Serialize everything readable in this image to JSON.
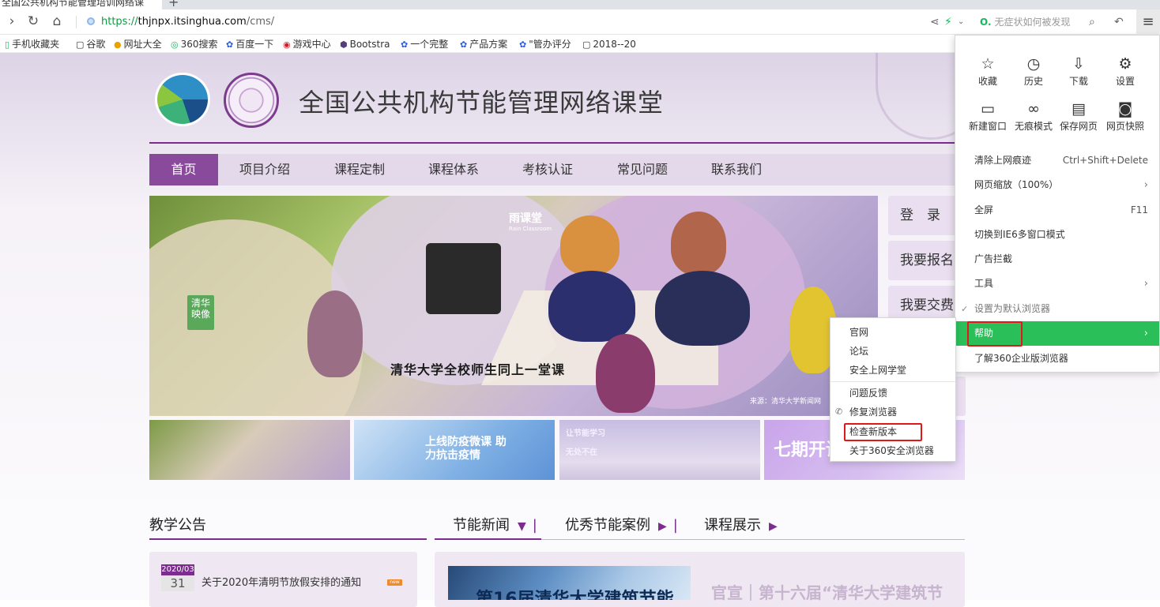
{
  "browser": {
    "tab_title": "全国公共机构节能管理培训网络课",
    "new_tab": "+",
    "url_scheme": "https://",
    "url_host": "thjnpx.itsinghua.com",
    "url_path": "/cms/",
    "search_hint": "无症状如何被发现",
    "menu_icon": "hamburger-icon"
  },
  "bookmarks": [
    {
      "label": "手机收藏夹",
      "icon": "phone-icon"
    },
    {
      "label": "谷歌",
      "icon": "page-icon"
    },
    {
      "label": "网址大全",
      "icon": "globe-icon"
    },
    {
      "label": "360搜索",
      "icon": "360-icon"
    },
    {
      "label": "百度一下",
      "icon": "baidu-icon"
    },
    {
      "label": "游戏中心",
      "icon": "game-icon"
    },
    {
      "label": "Bootstra",
      "icon": "bootstrap-icon"
    },
    {
      "label": "一个完整",
      "icon": "baidu-icon"
    },
    {
      "label": "产品方案",
      "icon": "baidu-icon"
    },
    {
      "label": "\"管办评分",
      "icon": "baidu-icon"
    },
    {
      "label": "2018--20",
      "icon": "page-icon"
    }
  ],
  "site": {
    "title": "全国公共机构节能管理网络课堂",
    "nav": [
      "首页",
      "项目介绍",
      "课程定制",
      "课程体系",
      "考核认证",
      "常见问题",
      "联系我们"
    ],
    "active_nav": "首页",
    "side_buttons": [
      "登　录",
      "我要报名",
      "我要交费"
    ],
    "banner": {
      "brand": "雨课堂",
      "brand_sub": "Rain Classroom",
      "badge": "清华映像",
      "caption": "清华大学全校师生同上一堂课",
      "credit": "来源：清华大学新闻网"
    },
    "thumbs": [
      {
        "text": ""
      },
      {
        "text": "上线防疫微课 助力抗击疫情"
      },
      {
        "text": "让节能学习 无处不在"
      },
      {
        "text": "七期开讲"
      }
    ],
    "sections": {
      "notice_title": "教学公告",
      "tab1": "节能新闻",
      "tab2": "优秀节能案例",
      "tab3": "课程展示",
      "arrow_down": "▼",
      "arrow_right": "▶",
      "sep": "|"
    },
    "notice": {
      "ym": "2020/03",
      "day": "31",
      "text": "关于2020年清明节放假安排的通知",
      "tag": "new"
    },
    "news": {
      "image_text": "第16届清华大学建筑节能",
      "headline": "官宣｜第十六届“清华大学建筑节"
    }
  },
  "menu": {
    "quick": [
      {
        "label": "收藏",
        "icon": "star-icon",
        "glyph": "☆"
      },
      {
        "label": "历史",
        "icon": "history-icon",
        "glyph": "◷"
      },
      {
        "label": "下载",
        "icon": "download-icon",
        "glyph": "⇩"
      },
      {
        "label": "设置",
        "icon": "gear-icon",
        "glyph": "⚙"
      },
      {
        "label": "新建窗口",
        "icon": "new-window-icon",
        "glyph": "▭"
      },
      {
        "label": "无痕模式",
        "icon": "incognito-icon",
        "glyph": "∞"
      },
      {
        "label": "保存网页",
        "icon": "save-icon",
        "glyph": "▤"
      },
      {
        "label": "网页快照",
        "icon": "camera-icon",
        "glyph": "◙"
      }
    ],
    "items": [
      {
        "label": "清除上网痕迹",
        "shortcut": "Ctrl+Shift+Delete"
      },
      {
        "label": "网页缩放（100%）",
        "arrow": "›"
      },
      {
        "label": "全屏",
        "shortcut": "F11"
      },
      {
        "label": "切换到IE6多窗口模式"
      },
      {
        "label": "广告拦截"
      },
      {
        "label": "工具",
        "arrow": "›"
      },
      {
        "label": "设置为默认浏览器",
        "check": "✓"
      },
      {
        "label": "帮助",
        "arrow": "›"
      },
      {
        "label": "了解360企业版浏览器"
      }
    ],
    "help_submenu": [
      "官网",
      "论坛",
      "安全上网学堂",
      "问题反馈",
      "修复浏览器",
      "检查新版本",
      "关于360安全浏览器"
    ]
  }
}
